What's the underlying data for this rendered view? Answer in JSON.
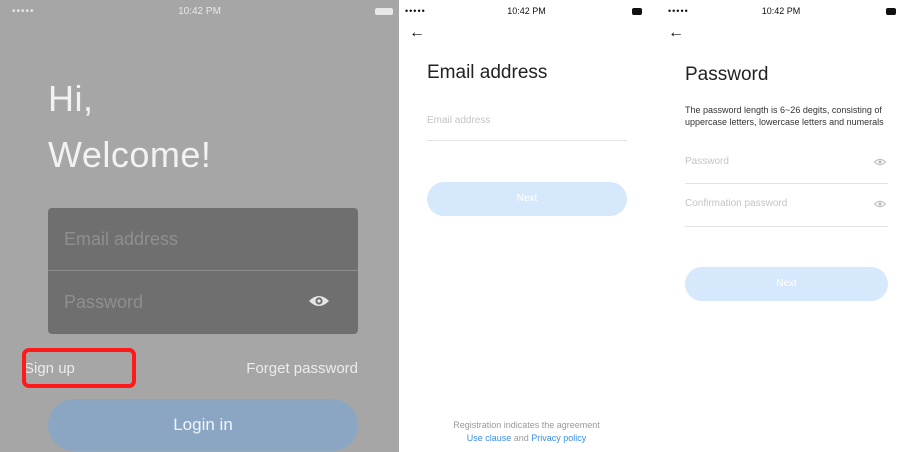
{
  "screen_login": {
    "status": {
      "signal": "•••••",
      "time": "10:42 PM"
    },
    "greeting_line1": "Hi,",
    "greeting_line2": "Welcome!",
    "email_placeholder": "Email address",
    "password_placeholder": "Password",
    "signup_label": "Sign up",
    "forget_label": "Forget password",
    "login_label": "Login in",
    "overlay_color": "#a6a6a6",
    "highlight_color": "#ff1a1a"
  },
  "screen_email": {
    "status": {
      "signal": "•••••",
      "time": "10:42 PM"
    },
    "back_icon": "←",
    "title": "Email address",
    "email_placeholder": "Email address",
    "next_label": "Next",
    "footer_line1": "Registration indicates the agreement",
    "footer_link1": "Use clause",
    "footer_and": " and ",
    "footer_link2": "Privacy policy",
    "accent_color": "#3a8ee6"
  },
  "screen_password": {
    "status": {
      "signal": "•••••",
      "time": "10:42 PM"
    },
    "back_icon": "←",
    "title": "Password",
    "description": "The password length is 6~26 degits, consisting of uppercase letters,  lowercase letters and numerals",
    "password_placeholder": "Password",
    "confirm_placeholder": "Confirmation password",
    "next_label": "Next",
    "button_color": "#d6e8fb"
  }
}
